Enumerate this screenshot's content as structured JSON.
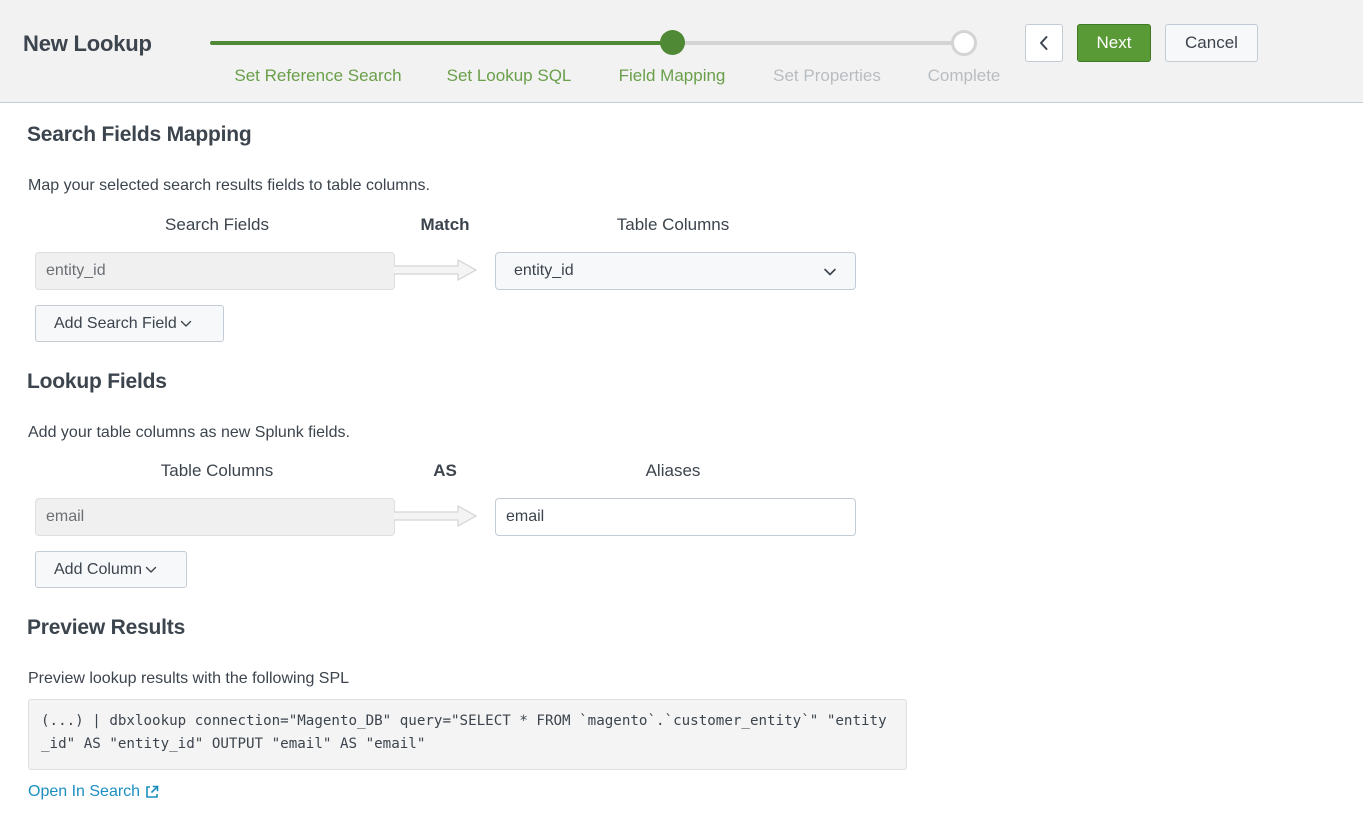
{
  "header": {
    "title": "New Lookup",
    "steps": [
      {
        "label": "Set Reference Search",
        "state": "done"
      },
      {
        "label": "Set Lookup SQL",
        "state": "done"
      },
      {
        "label": "Field Mapping",
        "state": "current"
      },
      {
        "label": "Set Properties",
        "state": "todo"
      },
      {
        "label": "Complete",
        "state": "todo"
      }
    ],
    "back_icon": "chevron-left-icon",
    "next_label": "Next",
    "cancel_label": "Cancel"
  },
  "search_mapping": {
    "heading": "Search Fields Mapping",
    "description": "Map your selected search results fields to table columns.",
    "col_left": "Search Fields",
    "col_mid": "Match",
    "col_right": "Table Columns",
    "rows": [
      {
        "search_field": "entity_id",
        "table_column": "entity_id"
      }
    ],
    "add_label": "Add Search Field"
  },
  "lookup_fields": {
    "heading": "Lookup Fields",
    "description": "Add your table columns as new Splunk fields.",
    "col_left": "Table Columns",
    "col_mid": "AS",
    "col_right": "Aliases",
    "rows": [
      {
        "column": "email",
        "alias": "email"
      }
    ],
    "add_label": "Add Column"
  },
  "preview": {
    "heading": "Preview Results",
    "description": "Preview lookup results with the following SPL",
    "spl": "(...) | dbxlookup connection=\"Magento_DB\" query=\"SELECT * FROM `magento`.`customer_entity`\" \"entity_id\" AS \"entity_id\" OUTPUT \"email\" AS \"email\"",
    "open_label": "Open In Search",
    "open_icon": "external-link-icon"
  },
  "colors": {
    "accent_green": "#5a9a36",
    "step_done": "#6a9f4a",
    "step_todo": "#b8bdc2",
    "link_blue": "#1a8fc0"
  }
}
